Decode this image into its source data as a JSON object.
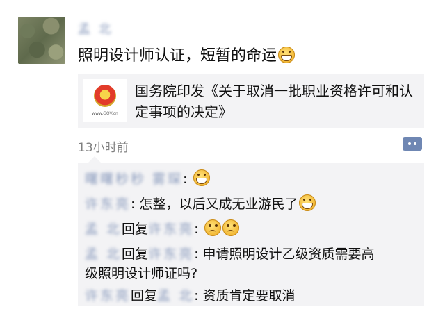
{
  "post": {
    "author": "孟 北",
    "text": "照明设计师认证，短暂的命运",
    "text_emoji": "grin-icon",
    "link": {
      "thumb_caption": "www.GOV.cn",
      "title": "国务院印发《关于取消一批职业资格许可和认定事项的决定》"
    },
    "timestamp": "13小时前"
  },
  "comments": [
    {
      "name": "曙曙秒秒 雾琛",
      "reply_word": "",
      "reply_to": "",
      "sep": ": ",
      "text": "",
      "emoji_count": 1,
      "emoji": "grin-icon"
    },
    {
      "name": "许东亮",
      "reply_word": "",
      "reply_to": "",
      "sep": ": ",
      "text": "怎整，以后又成无业游民了",
      "emoji_count": 1,
      "emoji": "grin-icon"
    },
    {
      "name": "孟 北",
      "reply_word": "回复",
      "reply_to": "许东亮",
      "sep": ": ",
      "text": "",
      "emoji_count": 2,
      "emoji": "puzzled-icon"
    },
    {
      "name": "孟 北",
      "reply_word": "回复",
      "reply_to": "许东亮",
      "sep": ": ",
      "text": "申请照明设计乙级资质需要高",
      "text2": "级照明设计师证吗?"
    },
    {
      "name": "许东亮",
      "reply_word": "回复",
      "reply_to": "孟 北",
      "sep": ": ",
      "text": "资质肯定要取消"
    }
  ]
}
